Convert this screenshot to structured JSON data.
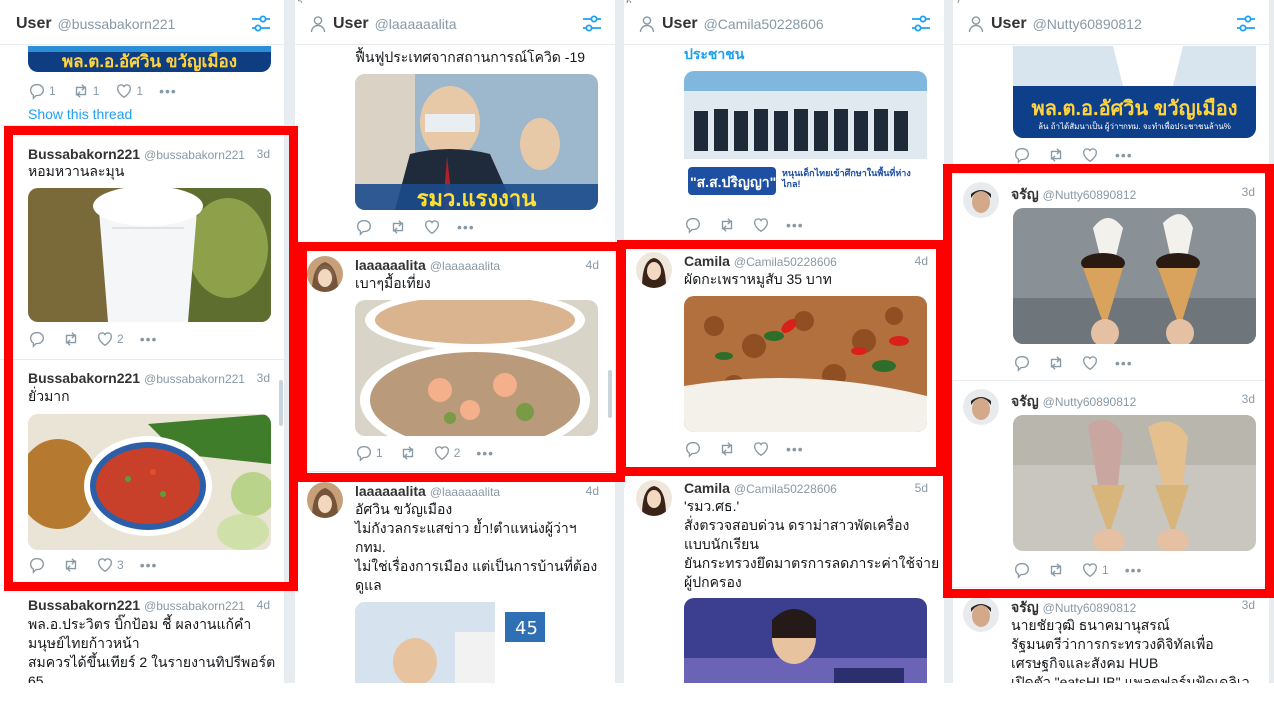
{
  "columns": [
    {
      "number": "",
      "title": "User",
      "handle": "@bussabakorn221",
      "top_fragment": {
        "actions": {
          "reply": "1",
          "retweet": "1",
          "like": "1"
        },
        "link": "Show this thread",
        "media_text": "พล.ต.อ.อัศวิน ขวัญเมือง"
      },
      "tweets": [
        {
          "name": "Bussabakorn221",
          "handle": "@bussabakorn221",
          "time": "3d",
          "text": "หอมหวานละมุน",
          "likes": "2"
        },
        {
          "name": "Bussabakorn221",
          "handle": "@bussabakorn221",
          "time": "3d",
          "text": "ยั่วมาก",
          "likes": "3"
        },
        {
          "name": "Bussabakorn221",
          "handle": "@bussabakorn221",
          "time": "4d",
          "text": "พล.อ.ประวิตร บิ๊กป้อม ชี้ ผลงานแก้คำ\nมนุษย์ไทยก้าวหน้า\nสมควรได้ขึ้นเทียร์ 2 ในรายงานทิปรีพอร์ต\n65"
        }
      ]
    },
    {
      "number": "5",
      "title": "User",
      "handle": "@laaaaaalita",
      "top_fragment": {
        "text": "ฟื้นฟูประเทศจากสถานการณ์โควิด -19",
        "media_text": "รมว.แรงงาน"
      },
      "tweets": [
        {
          "name": "laaaaaalita",
          "handle": "@laaaaaalita",
          "time": "4d",
          "text": "เบาๆมื้อเที่ยง",
          "replies": "1",
          "likes": "2"
        },
        {
          "name": "laaaaaalita",
          "handle": "@laaaaaalita",
          "time": "4d",
          "text": "อัศวิน ขวัญเมือง\nไม่กังวลกระแสข่าว ย้ำ!ตำแหน่งผู้ว่าฯ\nกทม.\nไม่ใช่เรื่องการเมือง แต่เป็นการบ้านที่ต้อง\nดูแล"
        }
      ]
    },
    {
      "number": "6",
      "title": "User",
      "handle": "@Camila50228606",
      "top_fragment": {
        "text": "ประชาชน",
        "media_text": "\"ส.ส.ปริญญา\"",
        "media_subtext": "หนุนเด็กไทยเข้าศึกษาในพื้นที่ห่างไกล!"
      },
      "tweets": [
        {
          "name": "Camila",
          "handle": "@Camila50228606",
          "time": "4d",
          "text": "ผัดกะเพราหมูสับ 35 บาท"
        },
        {
          "name": "Camila",
          "handle": "@Camila50228606",
          "time": "5d",
          "text": "'รมว.ศธ.'\nสั่งตรวจสอบด่วน ดราม่าสาวพัดเครื่อง\nแบบนักเรียน\nยันกระทรวงยึดมาตรการลดภาระค่าใช้จ่าย\nผู้ปกครอง"
        }
      ]
    },
    {
      "number": "7",
      "title": "User",
      "handle": "@Nutty60890812",
      "top_fragment": {
        "media_text": "พล.ต.อ.อัศวิน ขวัญเมือง",
        "media_subtext": "ล้น ถ้าได้สัมนาเป็น ผู้ว่าฯกทม. จะทำเพื่อประชาชนล้าน%"
      },
      "tweets": [
        {
          "name": "จรัญ",
          "handle": "@Nutty60890812",
          "time": "3d",
          "text": ""
        },
        {
          "name": "จรัญ",
          "handle": "@Nutty60890812",
          "time": "3d",
          "text": "",
          "likes": "1"
        },
        {
          "name": "จรัญ",
          "handle": "@Nutty60890812",
          "time": "3d",
          "text": "นายชัยวุฒิ ธนาคมานุสรณ์\nรัฐมนตรีว่าการกระทรวงดิจิทัลเพื่อ\nเศรษฐกิจและสังคม HUB\nเปิดตัว \"eatsHUB\" แพลตฟอร์มฟู้ดเดลิเว"
        }
      ]
    }
  ],
  "colors": {
    "highlight": "#ff0000",
    "link": "#1da1f2",
    "muted": "#8899a6",
    "divider": "#e6ecf0"
  }
}
